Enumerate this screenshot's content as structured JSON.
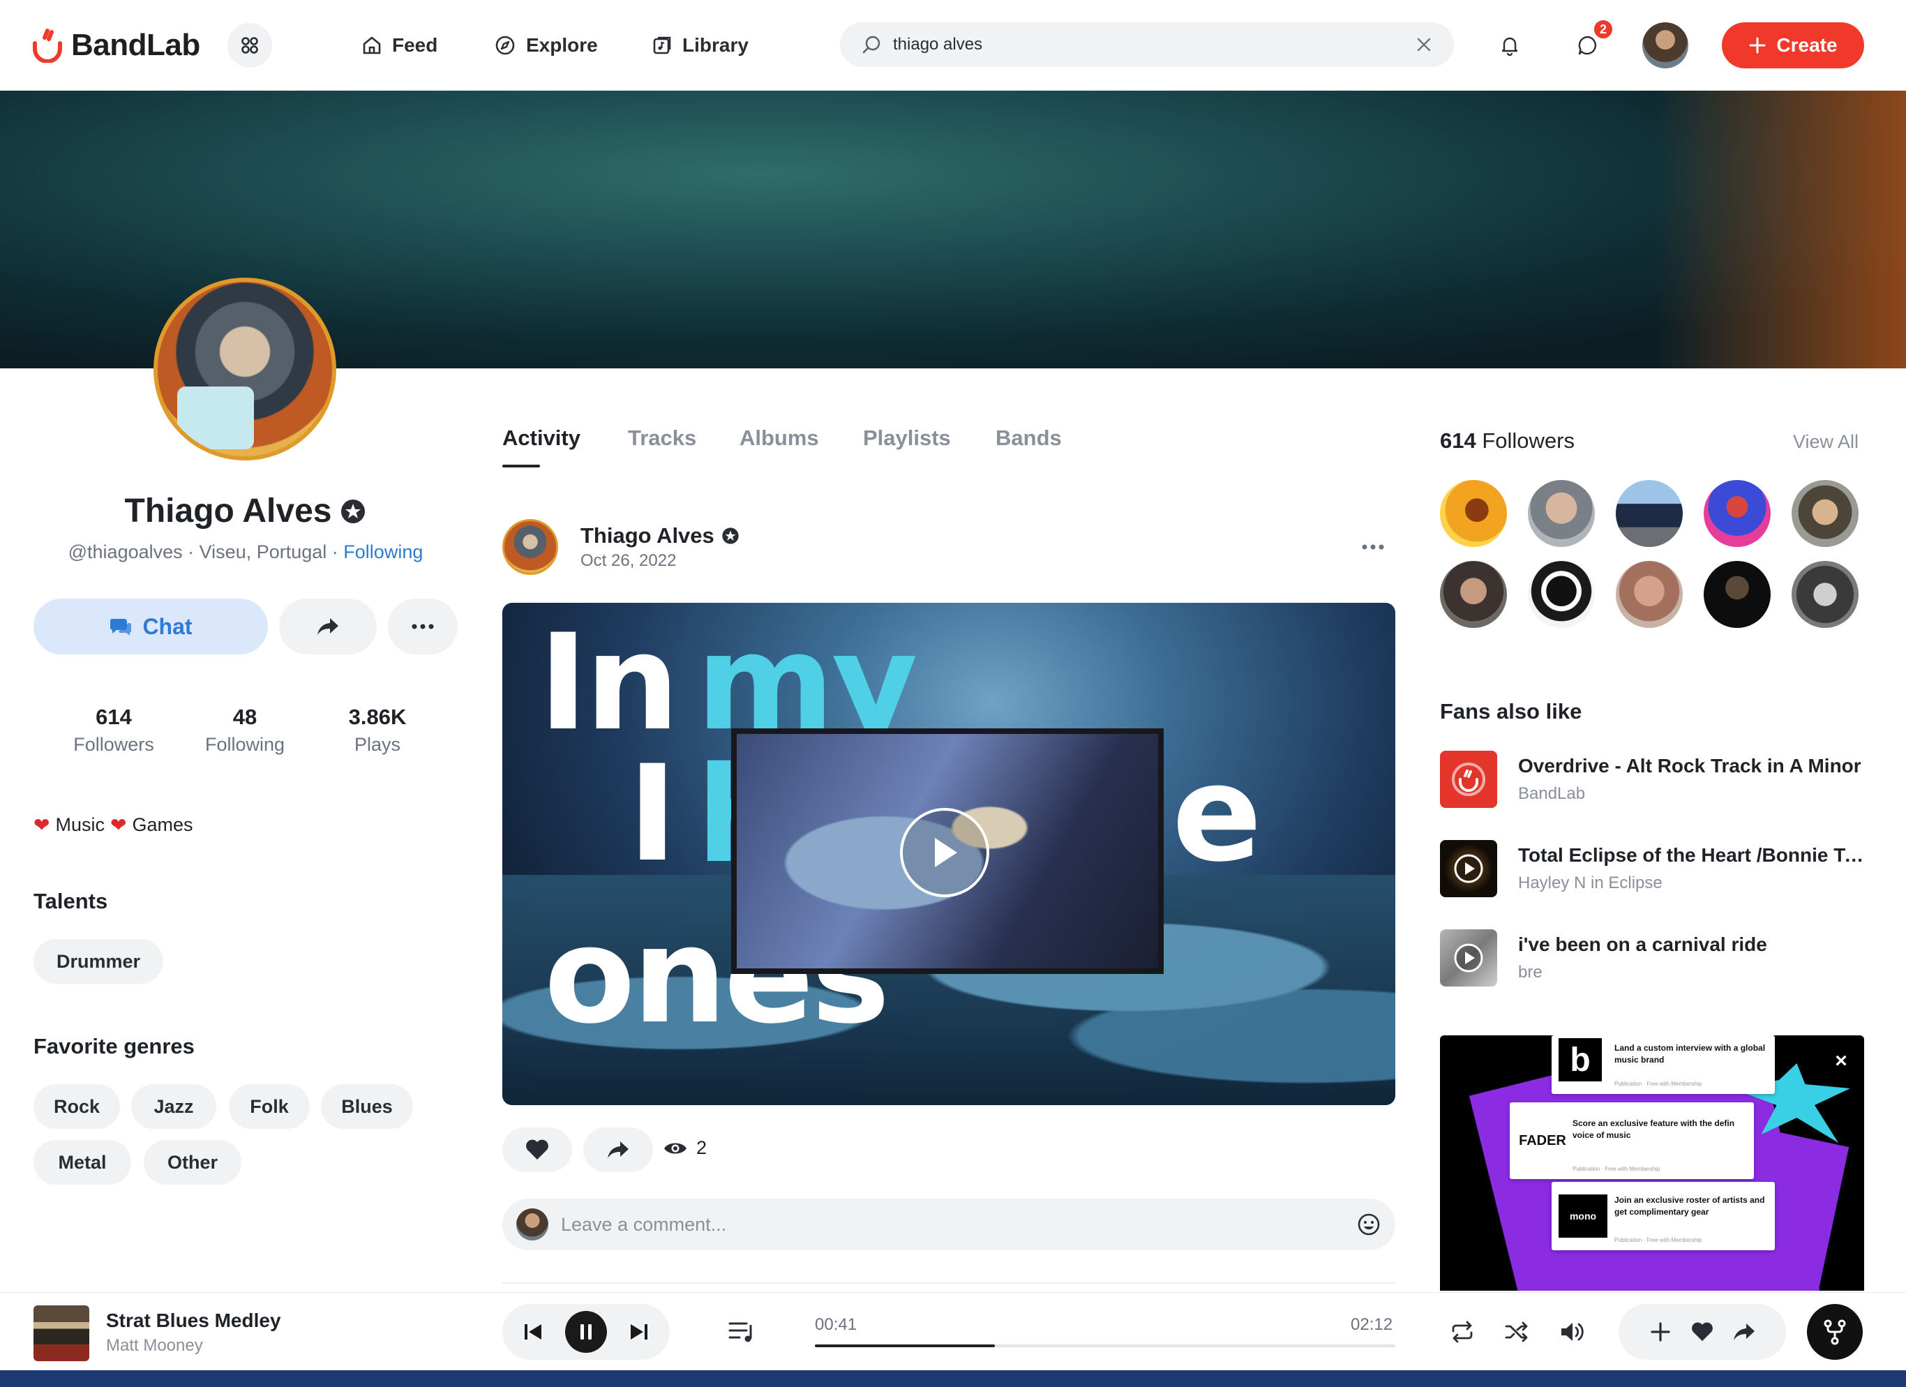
{
  "brand": {
    "name": "BandLab",
    "accent": "#f0392a",
    "link_color": "#2e7bd6"
  },
  "nav": {
    "items": [
      {
        "label": "Feed",
        "icon": "home-icon"
      },
      {
        "label": "Explore",
        "icon": "compass-icon"
      },
      {
        "label": "Library",
        "icon": "library-icon"
      }
    ],
    "search_value": "thiago alves",
    "messages_badge": "2",
    "create_label": "Create"
  },
  "profile": {
    "name": "Thiago Alves",
    "handle": "@thiagoalves",
    "location": "Viseu, Portugal",
    "relationship": "Following",
    "chat_label": "Chat",
    "stats": [
      {
        "value": "614",
        "label": "Followers"
      },
      {
        "value": "48",
        "label": "Following"
      },
      {
        "value": "3.86K",
        "label": "Plays"
      }
    ],
    "bio_parts": [
      "Music",
      "Games"
    ],
    "talents_title": "Talents",
    "talents": [
      "Drummer"
    ],
    "genres_title": "Favorite genres",
    "genres": [
      "Rock",
      "Jazz",
      "Folk",
      "Blues",
      "Metal",
      "Other"
    ]
  },
  "tabs": [
    "Activity",
    "Tracks",
    "Albums",
    "Playlists",
    "Bands"
  ],
  "post": {
    "author": "Thiago Alves",
    "date": "Oct 26, 2022",
    "video_text": [
      "In",
      "my hands",
      "I",
      "e",
      "ones"
    ],
    "views": "2",
    "comment_placeholder": "Leave a comment..."
  },
  "followers": {
    "count": "614",
    "label": "Followers",
    "view_all": "View All"
  },
  "fans_also_like": {
    "title": "Fans also like",
    "items": [
      {
        "title": "Overdrive - Alt Rock Track in A Minor",
        "sub": "BandLab"
      },
      {
        "title": "Total Eclipse of the Heart /Bonnie Tyler",
        "sub": "Hayley N in Eclipse"
      },
      {
        "title": "i've been on a carnival ride",
        "sub": "bre"
      }
    ]
  },
  "ad": {
    "cards": [
      {
        "logo": "b",
        "text": "Land a custom interview with a global music brand",
        "meta": "Publication · Free with Membership"
      },
      {
        "logo": "FADER",
        "text": "Score an exclusive feature with the defin voice of music",
        "meta": "Publication · Free with Membership"
      },
      {
        "logo": "mono",
        "text": "Join an exclusive roster of artists and get complimentary gear",
        "meta": "Publication · Free with Membership"
      }
    ],
    "close": "×"
  },
  "player": {
    "title": "Strat Blues Medley",
    "artist": "Matt Mooney",
    "current_time": "00:41",
    "duration": "02:12",
    "progress_fraction": 0.31
  }
}
